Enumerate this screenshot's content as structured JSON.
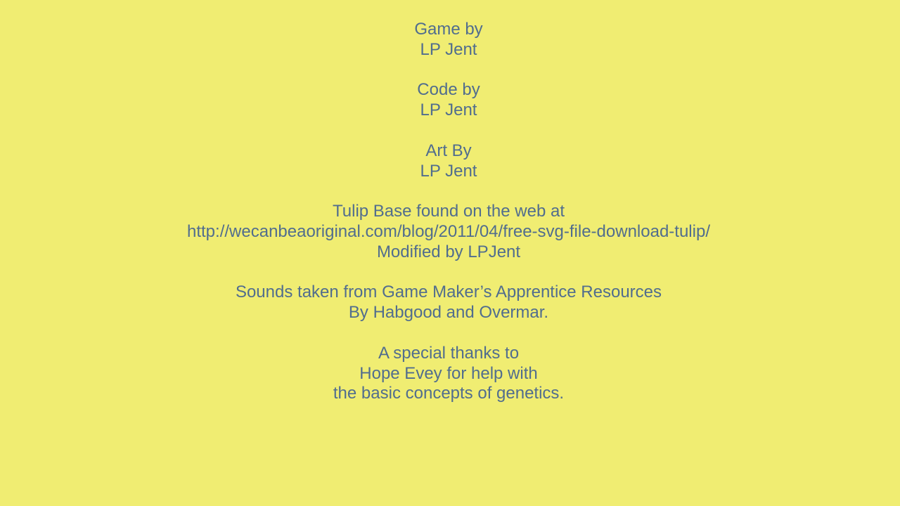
{
  "credits": {
    "game": [
      "Game by",
      "LP Jent"
    ],
    "code": [
      "Code by",
      "LP Jent"
    ],
    "art": [
      "Art By",
      "LP Jent"
    ],
    "tulip": [
      "Tulip Base found on the web at",
      "http://wecanbeaoriginal.com/blog/2011/04/free-svg-file-download-tulip/",
      "Modified by LPJent"
    ],
    "sounds": [
      "Sounds taken from Game Maker’s Apprentice Resources",
      "By Habgood and Overmar."
    ],
    "thanks": [
      "A special thanks to",
      "Hope Evey for help with",
      "the basic concepts of genetics."
    ]
  },
  "colors": {
    "background": "#f0ed72",
    "text": "#516d8e"
  }
}
